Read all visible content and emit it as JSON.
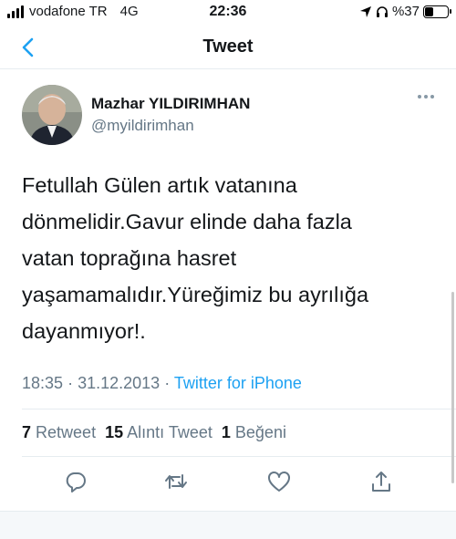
{
  "status_bar": {
    "carrier": "vodafone TR",
    "network": "4G",
    "time": "22:36",
    "battery": "%37",
    "battery_level": 0.37
  },
  "nav": {
    "title": "Tweet"
  },
  "tweet": {
    "author_name": "Mazhar YILDIRIMHAN",
    "author_handle": "@myildirimhan",
    "text_lines": [
      "Fetullah Gülen artık vatanına",
      "dönmelidir.Gavur elinde daha fazla",
      "vatan toprağına hasret",
      "yaşamamalıdır.Yüreğimiz bu ayrılığa",
      "dayanmıyor!."
    ],
    "time": "18:35",
    "date": "31.12.2013",
    "separator": "·",
    "source": "Twitter for iPhone"
  },
  "stats": {
    "retweets_count": "7",
    "retweets_label": "Retweet",
    "quotes_count": "15",
    "quotes_label": "Alıntı Tweet",
    "likes_count": "1",
    "likes_label": "Beğeni"
  },
  "colors": {
    "accent": "#1da1f2",
    "secondary_text": "#657786",
    "divider": "#e6ecf0"
  },
  "icons": [
    "back-chevron-icon",
    "more-icon",
    "reply-icon",
    "retweet-icon",
    "like-icon",
    "share-icon",
    "location-arrow-icon",
    "headphones-icon"
  ]
}
